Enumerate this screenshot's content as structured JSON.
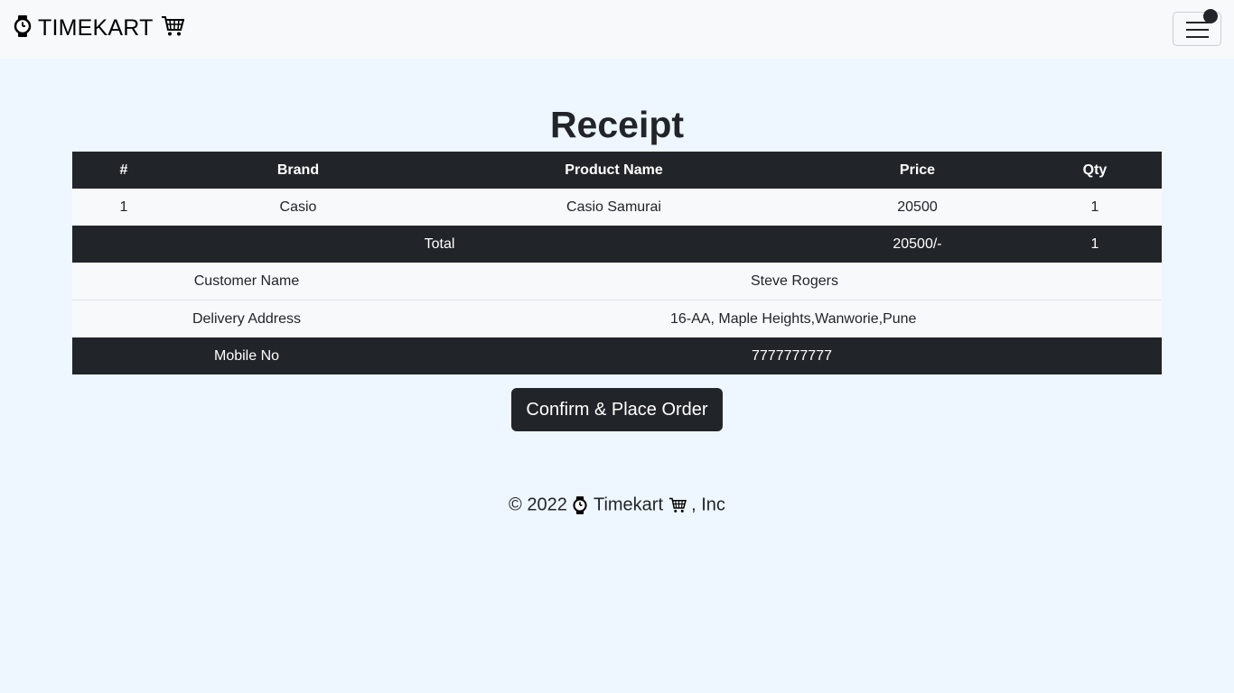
{
  "navbar": {
    "brand": "TIMEKART",
    "brand_icon": "watch-icon",
    "cart_icon": "cart-icon",
    "toggler_icon": "hamburger-icon"
  },
  "page": {
    "title": "Receipt"
  },
  "table": {
    "headers": [
      "#",
      "Brand",
      "Product Name",
      "Price",
      "Qty"
    ],
    "rows": [
      {
        "index": "1",
        "brand": "Casio",
        "product": "Casio Samurai",
        "price": "20500",
        "qty": "1"
      }
    ],
    "total": {
      "label": "Total",
      "price": "20500/-",
      "qty": "1"
    },
    "customer": {
      "name_label": "Customer Name",
      "name": "Steve Rogers",
      "address_label": "Delivery Address",
      "address": "16-AA, Maple Heights,Wanworie,Pune",
      "mobile_label": "Mobile No",
      "mobile": "7777777777"
    }
  },
  "actions": {
    "confirm_label": "Confirm & Place Order"
  },
  "footer": {
    "prefix": "© 2022",
    "name": "Timekart",
    "suffix": ", Inc"
  },
  "colors": {
    "dark": "#212529",
    "background": "#eef6ff",
    "navbar": "#f8f9fa"
  }
}
